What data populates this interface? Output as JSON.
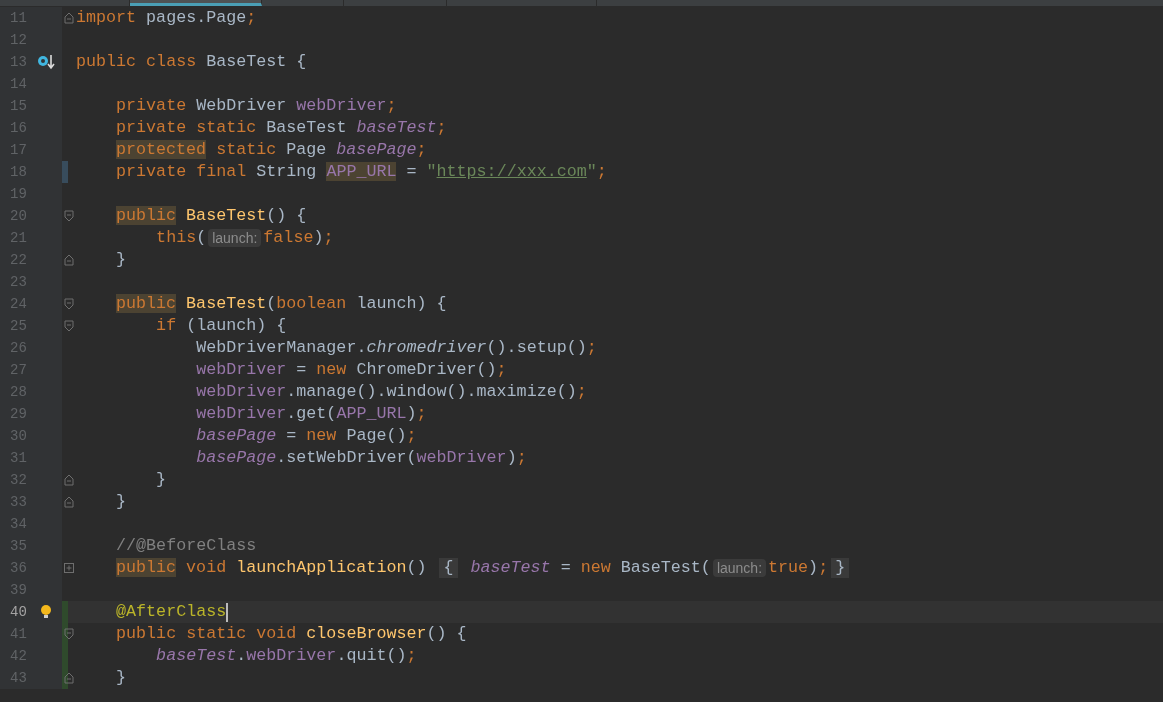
{
  "tabs": [
    {
      "selected": false
    },
    {
      "selected": true
    },
    {
      "selected": false
    },
    {
      "selected": false
    },
    {
      "selected": false
    }
  ],
  "lines": [
    {
      "number": "11",
      "current": false,
      "caret": false,
      "tokens": [
        {
          "kind": "k",
          "text": "import "
        },
        {
          "kind": "p",
          "text": "pages.Page"
        },
        {
          "kind": "k",
          "text": ";"
        }
      ]
    },
    {
      "number": "12",
      "current": false,
      "caret": false
    },
    {
      "number": "13",
      "current": false,
      "caret": false,
      "tokens": [
        {
          "kind": "k",
          "text": "public class "
        },
        {
          "kind": "p",
          "text": "BaseTest {"
        }
      ]
    },
    {
      "number": "14",
      "current": false,
      "caret": false
    },
    {
      "number": "15",
      "current": false,
      "caret": false,
      "tokens": [
        {
          "kind": "k",
          "text": "    private "
        },
        {
          "kind": "p",
          "text": "WebDriver "
        },
        {
          "kind": "f",
          "text": "webDriver"
        },
        {
          "kind": "k",
          "text": ";"
        }
      ]
    },
    {
      "number": "16",
      "current": false,
      "caret": false,
      "tokens": [
        {
          "kind": "k",
          "text": "    private static "
        },
        {
          "kind": "p",
          "text": "BaseTest "
        },
        {
          "kind": "fi",
          "text": "baseTest"
        },
        {
          "kind": "k",
          "text": ";"
        }
      ]
    },
    {
      "number": "17",
      "current": false,
      "caret": false,
      "tokens": [
        {
          "kind": "khl",
          "text": "protected"
        },
        {
          "kind": "k",
          "text": " static "
        },
        {
          "kind": "p",
          "text": "Page "
        },
        {
          "kind": "fi",
          "text": "basePage"
        },
        {
          "kind": "k",
          "text": ";"
        }
      ]
    },
    {
      "number": "18",
      "current": false,
      "caret": false,
      "tokens": [
        {
          "kind": "k",
          "text": "    private final "
        },
        {
          "kind": "p",
          "text": "String "
        },
        {
          "kind": "fhl",
          "text": "APP_URL"
        },
        {
          "kind": "p",
          "text": " = "
        },
        {
          "kind": "s",
          "text": "\""
        },
        {
          "kind": "u",
          "text": "https://xxx.com"
        },
        {
          "kind": "s",
          "text": "\""
        },
        {
          "kind": "k",
          "text": ";"
        }
      ]
    },
    {
      "number": "19",
      "current": false,
      "caret": false
    },
    {
      "number": "20",
      "current": false,
      "caret": false,
      "tokens": [
        {
          "kind": "khl",
          "text": "public"
        },
        {
          "kind": "d",
          "text": " BaseTest"
        },
        {
          "kind": "p",
          "text": "() {"
        }
      ]
    },
    {
      "number": "21",
      "current": false,
      "caret": false,
      "tokens": [
        {
          "kind": "k",
          "text": "        this"
        },
        {
          "kind": "p",
          "text": "("
        },
        {
          "kind": "hint",
          "text": "launch:"
        },
        {
          "kind": "k",
          "text": "false"
        },
        {
          "kind": "p",
          "text": ")"
        },
        {
          "kind": "k",
          "text": ";"
        }
      ]
    },
    {
      "number": "22",
      "current": false,
      "caret": false,
      "tokens": [
        {
          "kind": "p",
          "text": "    }"
        }
      ]
    },
    {
      "number": "23",
      "current": false,
      "caret": false
    },
    {
      "number": "24",
      "current": false,
      "caret": false,
      "tokens": [
        {
          "kind": "khl",
          "text": "public"
        },
        {
          "kind": "d",
          "text": " BaseTest"
        },
        {
          "kind": "p",
          "text": "("
        },
        {
          "kind": "k",
          "text": "boolean "
        },
        {
          "kind": "p",
          "text": "launch) {"
        }
      ]
    },
    {
      "number": "25",
      "current": false,
      "caret": false,
      "tokens": [
        {
          "kind": "k",
          "text": "        if "
        },
        {
          "kind": "p",
          "text": "(launch) {"
        }
      ]
    },
    {
      "number": "26",
      "current": false,
      "caret": false,
      "tokens": [
        {
          "kind": "p",
          "text": "            WebDriverManager."
        },
        {
          "kind": "mi",
          "text": "chromedriver"
        },
        {
          "kind": "p",
          "text": "().setup()"
        },
        {
          "kind": "k",
          "text": ";"
        }
      ]
    },
    {
      "number": "27",
      "current": false,
      "caret": false,
      "tokens": [
        {
          "kind": "f",
          "text": "            webDriver"
        },
        {
          "kind": "p",
          "text": " = "
        },
        {
          "kind": "k",
          "text": "new "
        },
        {
          "kind": "p",
          "text": "ChromeDriver()"
        },
        {
          "kind": "k",
          "text": ";"
        }
      ]
    },
    {
      "number": "28",
      "current": false,
      "caret": false,
      "tokens": [
        {
          "kind": "f",
          "text": "            webDriver"
        },
        {
          "kind": "p",
          "text": ".manage().window().maximize()"
        },
        {
          "kind": "k",
          "text": ";"
        }
      ]
    },
    {
      "number": "29",
      "current": false,
      "caret": false,
      "tokens": [
        {
          "kind": "f",
          "text": "            webDriver"
        },
        {
          "kind": "p",
          "text": ".get("
        },
        {
          "kind": "f",
          "text": "APP_URL"
        },
        {
          "kind": "p",
          "text": ")"
        },
        {
          "kind": "k",
          "text": ";"
        }
      ]
    },
    {
      "number": "30",
      "current": false,
      "caret": false,
      "tokens": [
        {
          "kind": "fi",
          "text": "            basePage"
        },
        {
          "kind": "p",
          "text": " = "
        },
        {
          "kind": "k",
          "text": "new "
        },
        {
          "kind": "p",
          "text": "Page()"
        },
        {
          "kind": "k",
          "text": ";"
        }
      ]
    },
    {
      "number": "31",
      "current": false,
      "caret": false,
      "tokens": [
        {
          "kind": "fi",
          "text": "            basePage"
        },
        {
          "kind": "p",
          "text": ".setWebDriver("
        },
        {
          "kind": "f",
          "text": "webDriver"
        },
        {
          "kind": "p",
          "text": ")"
        },
        {
          "kind": "k",
          "text": ";"
        }
      ]
    },
    {
      "number": "32",
      "current": false,
      "caret": false,
      "tokens": [
        {
          "kind": "p",
          "text": "        }"
        }
      ]
    },
    {
      "number": "33",
      "current": false,
      "caret": false,
      "tokens": [
        {
          "kind": "p",
          "text": "    }"
        }
      ]
    },
    {
      "number": "34",
      "current": false,
      "caret": false
    },
    {
      "number": "35",
      "current": false,
      "caret": false,
      "tokens": [
        {
          "kind": "c",
          "text": "    //@BeforeClass"
        }
      ]
    },
    {
      "number": "36",
      "current": false,
      "caret": false,
      "tokens": [
        {
          "kind": "khl",
          "text": "public"
        },
        {
          "kind": "k",
          "text": " void "
        },
        {
          "kind": "d",
          "text": "launchApplication"
        },
        {
          "kind": "p",
          "text": "() "
        },
        {
          "kind": "fold",
          "text": "{"
        },
        {
          "kind": "fi",
          "text": " baseTest"
        },
        {
          "kind": "p",
          "text": " = "
        },
        {
          "kind": "k",
          "text": "new "
        },
        {
          "kind": "p",
          "text": "BaseTest("
        },
        {
          "kind": "hint",
          "text": "launch:"
        },
        {
          "kind": "k",
          "text": "true"
        },
        {
          "kind": "p",
          "text": ")"
        },
        {
          "kind": "k",
          "text": ";"
        },
        {
          "kind": "fold",
          "text": "}"
        }
      ]
    },
    {
      "number": "39",
      "current": false,
      "caret": false
    },
    {
      "number": "40",
      "current": true,
      "caret": true,
      "tokens": [
        {
          "kind": "a",
          "text": "    @AfterClass"
        }
      ]
    },
    {
      "number": "41",
      "current": false,
      "caret": false,
      "tokens": [
        {
          "kind": "k",
          "text": "    public static void "
        },
        {
          "kind": "d",
          "text": "closeBrowser"
        },
        {
          "kind": "p",
          "text": "() {"
        }
      ]
    },
    {
      "number": "42",
      "current": false,
      "caret": false,
      "tokens": [
        {
          "kind": "fi",
          "text": "        baseTest"
        },
        {
          "kind": "p",
          "text": "."
        },
        {
          "kind": "f",
          "text": "webDriver"
        },
        {
          "kind": "p",
          "text": ".quit()"
        },
        {
          "kind": "k",
          "text": ";"
        }
      ]
    },
    {
      "number": "43",
      "current": false,
      "caret": false,
      "tokens": [
        {
          "kind": "p",
          "text": "    }"
        }
      ]
    }
  ]
}
